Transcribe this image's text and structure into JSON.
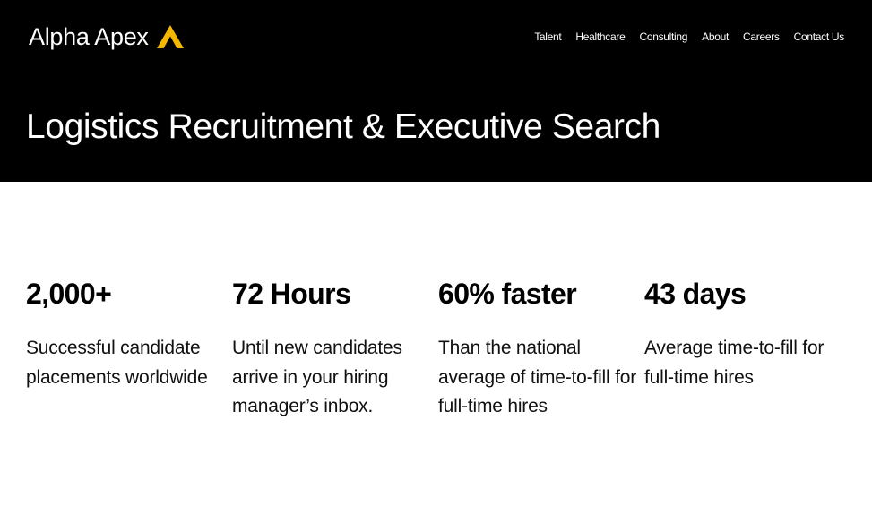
{
  "brand": {
    "name": "Alpha Apex",
    "accent_color": "#f5b800",
    "icon": "apex-chevron-logo-icon"
  },
  "nav": {
    "items": [
      {
        "label": "Talent"
      },
      {
        "label": "Healthcare"
      },
      {
        "label": "Consulting"
      },
      {
        "label": "About"
      },
      {
        "label": "Careers"
      },
      {
        "label": "Contact Us"
      }
    ]
  },
  "hero": {
    "title": "Logistics Recruitment & Executive Search",
    "background_color": "#000000"
  },
  "stats": [
    {
      "value": "2,000+",
      "description": "Successful candidate placements worldwide"
    },
    {
      "value": "72 Hours",
      "description": "Until new candidates arrive in your hiring manager’s inbox."
    },
    {
      "value": "60% faster",
      "description": "Than the national average of time-to-fill for full-time hires"
    },
    {
      "value": "43 days",
      "description": "Average time-to-fill for full-time hires"
    }
  ]
}
